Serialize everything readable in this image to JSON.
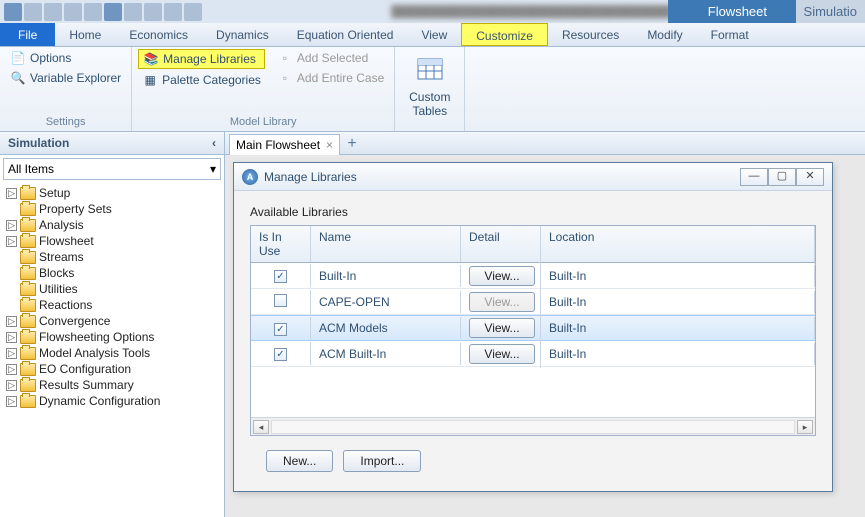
{
  "titlebar": {
    "context_tab": "Flowsheet",
    "sim_tab": "Simulatio"
  },
  "menu": {
    "file": "File",
    "home": "Home",
    "economics": "Economics",
    "dynamics": "Dynamics",
    "eqn": "Equation Oriented",
    "view": "View",
    "customize": "Customize",
    "resources": "Resources",
    "modify": "Modify",
    "format": "Format"
  },
  "ribbon": {
    "settings": {
      "options": "Options",
      "varexp": "Variable Explorer",
      "label": "Settings"
    },
    "modellib": {
      "manage": "Manage Libraries",
      "palette": "Palette Categories",
      "addsel": "Add Selected",
      "addcase": "Add Entire Case",
      "label": "Model Library"
    },
    "custom": {
      "label": "Custom\nTables"
    }
  },
  "sidebar": {
    "title": "Simulation",
    "combo": "All Items",
    "items": [
      {
        "exp": "▷",
        "label": "Setup"
      },
      {
        "exp": "",
        "label": "Property Sets"
      },
      {
        "exp": "▷",
        "label": "Analysis"
      },
      {
        "exp": "▷",
        "label": "Flowsheet"
      },
      {
        "exp": "",
        "label": "Streams"
      },
      {
        "exp": "",
        "label": "Blocks"
      },
      {
        "exp": "",
        "label": "Utilities"
      },
      {
        "exp": "",
        "label": "Reactions"
      },
      {
        "exp": "▷",
        "label": "Convergence"
      },
      {
        "exp": "▷",
        "label": "Flowsheeting Options"
      },
      {
        "exp": "▷",
        "label": "Model Analysis Tools"
      },
      {
        "exp": "▷",
        "label": "EO Configuration"
      },
      {
        "exp": "▷",
        "label": "Results Summary"
      },
      {
        "exp": "▷",
        "label": "Dynamic Configuration"
      }
    ]
  },
  "tabs": {
    "main": "Main Flowsheet"
  },
  "dialog": {
    "title": "Manage Libraries",
    "section": "Available Libraries",
    "cols": {
      "c1": "Is In Use",
      "c2": "Name",
      "c3": "Detail",
      "c4": "Location"
    },
    "viewbtn": "View...",
    "rows": [
      {
        "checked": true,
        "name": "Built-In",
        "view": true,
        "loc": "Built-In",
        "sel": false
      },
      {
        "checked": false,
        "name": "CAPE-OPEN",
        "view": false,
        "loc": "Built-In",
        "sel": false
      },
      {
        "checked": true,
        "name": "ACM Models",
        "view": true,
        "loc": "Built-In",
        "sel": true
      },
      {
        "checked": true,
        "name": "ACM Built-In",
        "view": true,
        "loc": "Built-In",
        "sel": false
      }
    ],
    "new": "New...",
    "import": "Import..."
  }
}
